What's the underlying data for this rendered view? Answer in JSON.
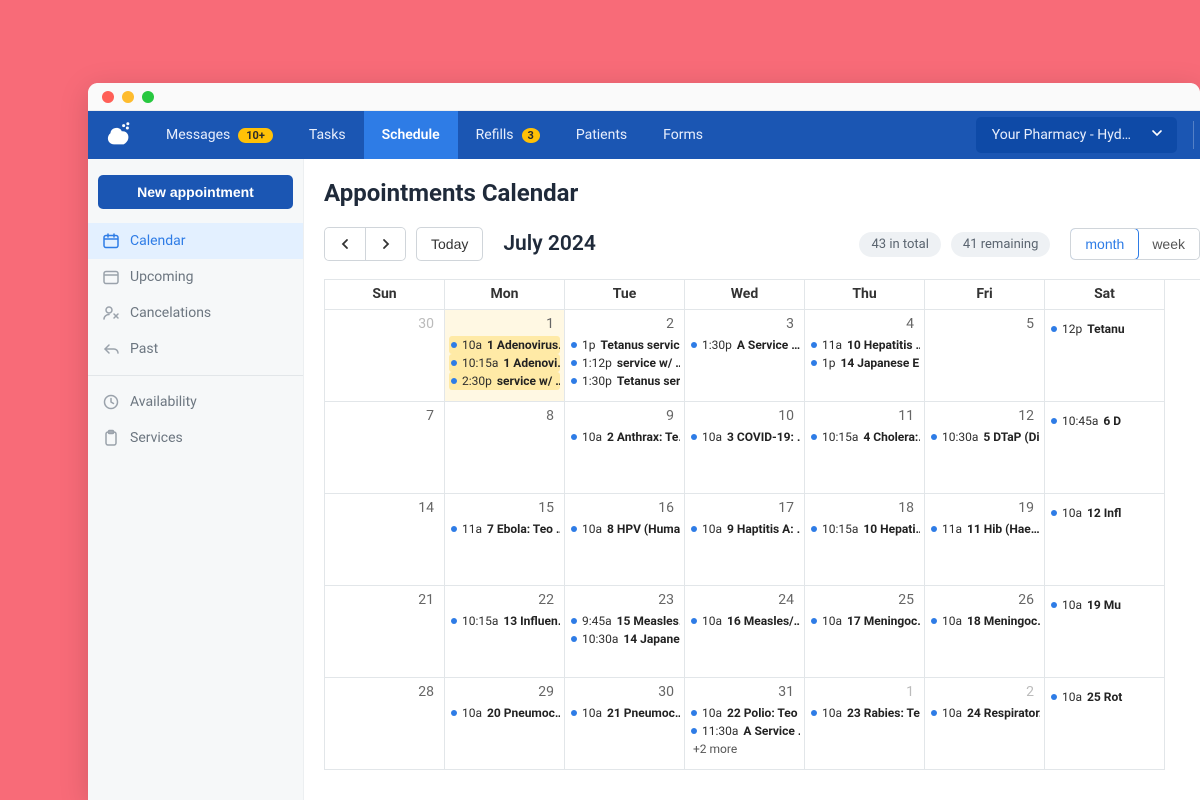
{
  "nav": {
    "items": [
      {
        "label": "Messages",
        "badge": "10+"
      },
      {
        "label": "Tasks"
      },
      {
        "label": "Schedule"
      },
      {
        "label": "Refills",
        "badge": "3"
      },
      {
        "label": "Patients"
      },
      {
        "label": "Forms"
      }
    ],
    "pharmacy": "Your Pharmacy - Hyd…"
  },
  "sidebar": {
    "new_appointment": "New appointment",
    "items": [
      "Calendar",
      "Upcoming",
      "Cancelations",
      "Past"
    ],
    "secondary": [
      "Availability",
      "Services"
    ]
  },
  "page": {
    "title": "Appointments Calendar",
    "month": "July 2024",
    "today": "Today",
    "in_total": "43 in total",
    "remaining": "41 remaining",
    "views": {
      "month": "month",
      "week": "week"
    },
    "weekdays": [
      "Sun",
      "Mon",
      "Tue",
      "Wed",
      "Thu",
      "Fri",
      "Sat"
    ]
  },
  "calendar": {
    "rows": [
      [
        {
          "day": "30",
          "muted": true,
          "events": []
        },
        {
          "day": "1",
          "today": true,
          "events": [
            {
              "time": "10a",
              "title": "1 Adenovirus…",
              "today": true
            },
            {
              "time": "10:15a",
              "title": "1 Adenovi…",
              "today": true
            },
            {
              "time": "2:30p",
              "title": "service w/ …",
              "today": true
            }
          ]
        },
        {
          "day": "2",
          "events": [
            {
              "time": "1p",
              "title": "Tetanus servic…"
            },
            {
              "time": "1:12p",
              "title": "service w/ …"
            },
            {
              "time": "1:30p",
              "title": "Tetanus ser…"
            }
          ]
        },
        {
          "day": "3",
          "events": [
            {
              "time": "1:30p",
              "title": "A Service …"
            }
          ]
        },
        {
          "day": "4",
          "events": [
            {
              "time": "11a",
              "title": "10 Hepatitis …"
            },
            {
              "time": "1p",
              "title": "14 Japanese E…"
            }
          ]
        },
        {
          "day": "5",
          "events": []
        },
        {
          "day": "",
          "events": [
            {
              "time": "12p",
              "title": "Tetanu"
            }
          ]
        }
      ],
      [
        {
          "day": "7",
          "events": []
        },
        {
          "day": "8",
          "events": []
        },
        {
          "day": "9",
          "events": [
            {
              "time": "10a",
              "title": "2 Anthrax: Te…"
            }
          ]
        },
        {
          "day": "10",
          "events": [
            {
              "time": "10a",
              "title": "3 COVID-19: …"
            }
          ]
        },
        {
          "day": "11",
          "events": [
            {
              "time": "10:15a",
              "title": "4 Cholera:…"
            }
          ]
        },
        {
          "day": "12",
          "events": [
            {
              "time": "10:30a",
              "title": "5 DTaP (Di…"
            }
          ]
        },
        {
          "day": "",
          "events": [
            {
              "time": "10:45a",
              "title": "6 D"
            }
          ]
        }
      ],
      [
        {
          "day": "14",
          "events": []
        },
        {
          "day": "15",
          "events": [
            {
              "time": "11a",
              "title": "7 Ebola: Teo …"
            }
          ]
        },
        {
          "day": "16",
          "events": [
            {
              "time": "10a",
              "title": "8 HPV (Huma…"
            }
          ]
        },
        {
          "day": "17",
          "events": [
            {
              "time": "10a",
              "title": "9 Haptitis A: …"
            }
          ]
        },
        {
          "day": "18",
          "events": [
            {
              "time": "10:15a",
              "title": "10 Hepati…"
            }
          ]
        },
        {
          "day": "19",
          "events": [
            {
              "time": "11a",
              "title": "11 Hib (Hae…"
            }
          ]
        },
        {
          "day": "",
          "events": [
            {
              "time": "10a",
              "title": "12 Infl"
            }
          ]
        }
      ],
      [
        {
          "day": "21",
          "events": []
        },
        {
          "day": "22",
          "events": [
            {
              "time": "10:15a",
              "title": "13 Influen…"
            }
          ]
        },
        {
          "day": "23",
          "events": [
            {
              "time": "9:45a",
              "title": "15 Measles…"
            },
            {
              "time": "10:30a",
              "title": "14 Japane…"
            }
          ]
        },
        {
          "day": "24",
          "events": [
            {
              "time": "10a",
              "title": "16 Measles/…"
            }
          ]
        },
        {
          "day": "25",
          "events": [
            {
              "time": "10a",
              "title": "17 Meningoc…"
            }
          ]
        },
        {
          "day": "26",
          "events": [
            {
              "time": "10a",
              "title": "18 Meningoc…"
            }
          ]
        },
        {
          "day": "",
          "events": [
            {
              "time": "10a",
              "title": "19 Mu"
            }
          ]
        }
      ],
      [
        {
          "day": "28",
          "events": []
        },
        {
          "day": "29",
          "events": [
            {
              "time": "10a",
              "title": "20 Pneumoc…"
            }
          ]
        },
        {
          "day": "30",
          "events": [
            {
              "time": "10a",
              "title": "21 Pneumoc…"
            }
          ]
        },
        {
          "day": "31",
          "events": [
            {
              "time": "10a",
              "title": "22 Polio: Teo …"
            },
            {
              "time": "11:30a",
              "title": "A Service …"
            }
          ],
          "more": "+2 more"
        },
        {
          "day": "1",
          "muted": true,
          "events": [
            {
              "time": "10a",
              "title": "23 Rabies: Te…"
            }
          ]
        },
        {
          "day": "2",
          "muted": true,
          "events": [
            {
              "time": "10a",
              "title": "24 Respirator…"
            }
          ]
        },
        {
          "day": "",
          "events": [
            {
              "time": "10a",
              "title": "25 Rot"
            }
          ]
        }
      ]
    ]
  }
}
